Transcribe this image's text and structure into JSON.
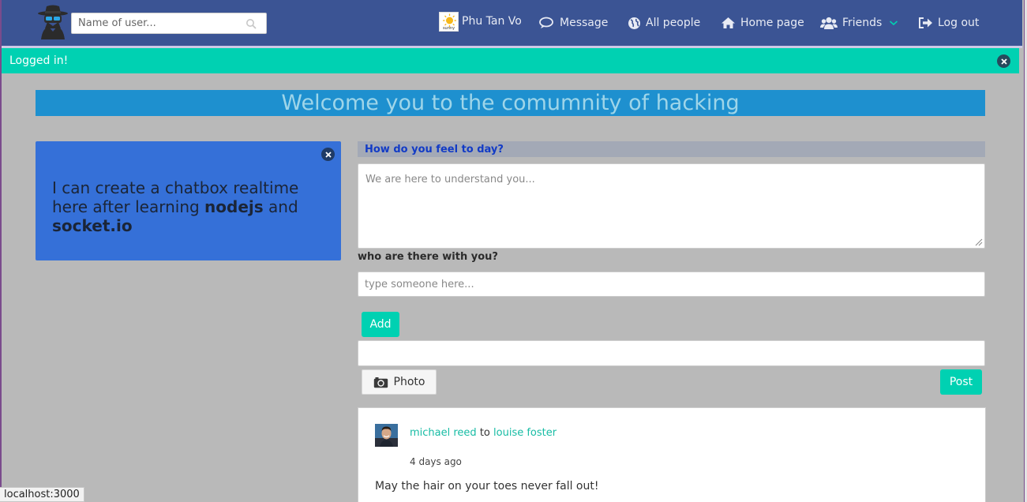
{
  "navbar": {
    "search_placeholder": "Name of user...",
    "user_name": "Phu Tan Vo",
    "user_avatar_caption": "sunny",
    "items": [
      {
        "label": "Message",
        "icon": "chat-icon"
      },
      {
        "label": "All people",
        "icon": "globe-icon"
      },
      {
        "label": "Home page",
        "icon": "home-icon"
      },
      {
        "label": "Friends",
        "icon": "users-icon"
      },
      {
        "label": "Log out",
        "icon": "logout-icon"
      }
    ],
    "colors": {
      "background": "#3b5494",
      "accent": "#00d1b2"
    }
  },
  "alert": {
    "text": "Logged in!"
  },
  "hero": {
    "title": "Welcome you to the comumnity of hacking"
  },
  "info_card": {
    "text_before": "I can create a chatbox realtime here after learning ",
    "bold_1": "nodejs",
    "text_middle": " and ",
    "bold_2": "socket.io"
  },
  "form": {
    "feel_label": "How do you feel to day?",
    "feel_placeholder": "We are here to understand you...",
    "who_label": "who are there with you?",
    "who_placeholder": "type someone here...",
    "add_label": "Add",
    "photo_label": "Photo",
    "post_label": "Post"
  },
  "feed": {
    "posts": [
      {
        "author": "michael reed",
        "connector": "to",
        "target": "louise foster",
        "time": "4 days ago",
        "text": "May the hair on your toes never fall out!"
      }
    ]
  },
  "status_bar": {
    "url": "localhost:3000"
  }
}
